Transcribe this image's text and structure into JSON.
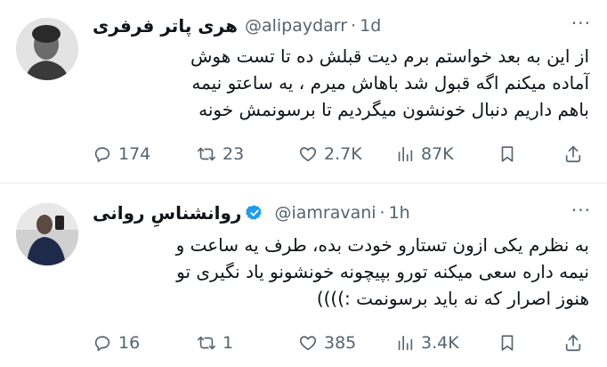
{
  "tweets": [
    {
      "name": "هری پاتر فرفری",
      "handle": "@alipaydarr",
      "time": "1d",
      "more": "···",
      "lines": [
        "از این به بعد خواستم برم دیت قبلش ده تا تست هوش",
        "آماده میکنم اگه قبول شد باهاش میرم ، یه ساعتو نیمه",
        "باهم داریم دنبال خونشون میگردیم تا برسونمش خونه"
      ],
      "stats": {
        "replies": "174",
        "retweets": "23",
        "likes": "2.7K",
        "views": "87K"
      },
      "verified": false
    },
    {
      "name": "روانشناسِ روانی",
      "handle": "@iamravani",
      "time": "1h",
      "more": "···",
      "lines": [
        "به نظرم یکی ازون تستارو خودت بده، طرف یه ساعت و",
        "نیمه داره سعی میکنه تورو بپیچونه خونشونو یاد نگیری تو",
        "هنوز اصرار که نه باید برسونمت :))))"
      ],
      "stats": {
        "replies": "16",
        "retweets": "1",
        "likes": "385",
        "views": "3.4K"
      },
      "verified": true
    }
  ],
  "colors": {
    "text": "#0f1419",
    "secondary": "#536471",
    "verified_blue": "#1d9bf0",
    "divider": "#e6e9ec"
  },
  "icons": [
    "reply-icon",
    "retweet-icon",
    "like-icon",
    "views-icon",
    "bookmark-icon",
    "share-icon",
    "verified-badge-icon",
    "more-icon"
  ]
}
